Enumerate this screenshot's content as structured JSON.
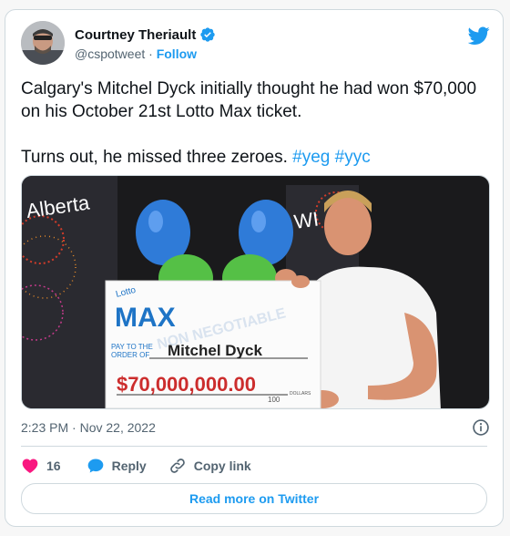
{
  "author": {
    "name": "Courtney Theriault",
    "handle": "@cspotweet",
    "separator": "·",
    "follow_label": "Follow"
  },
  "tweet": {
    "line1": "Calgary's Mitchel Dyck initially thought he had won $70,000 on his October 21st Lotto Max ticket.",
    "line2_text": "Turns out, he missed three zeroes.",
    "hashtags": [
      "#yeg",
      "#yyc"
    ]
  },
  "media": {
    "banner_left": "Alberta",
    "banner_right": "WI",
    "cheque": {
      "brand_small": "Lotto",
      "brand_big": "MAX",
      "watermark": "NON NEGOTIABLE",
      "pay_to_line1": "PAY TO THE",
      "pay_to_line2": "ORDER OF",
      "payee": "Mitchel Dyck",
      "amount": "$70,000,000.00",
      "cents_label": "DOLLARS",
      "cents": "100"
    }
  },
  "meta": {
    "timestamp": "2:23 PM · Nov 22, 2022"
  },
  "actions": {
    "like_count": "16",
    "reply_label": "Reply",
    "copy_link_label": "Copy link"
  },
  "read_more_label": "Read more on Twitter",
  "colors": {
    "accent": "#1d9bf0",
    "like": "#f91880",
    "text": "#0f1419",
    "secondary": "#536471"
  }
}
